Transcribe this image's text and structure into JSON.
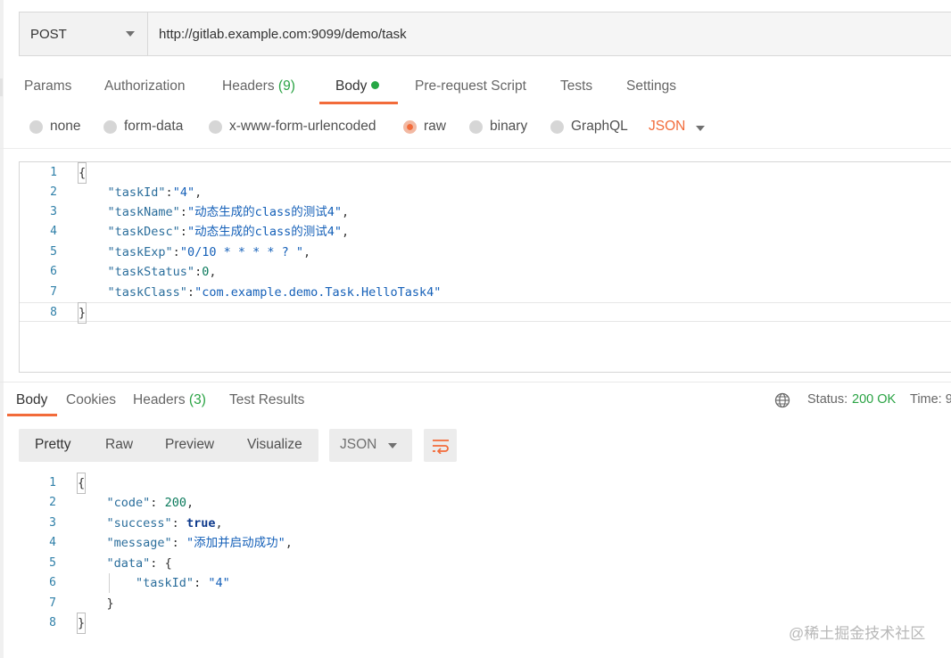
{
  "request": {
    "method": "POST",
    "url": "http://gitlab.example.com:9099/demo/task"
  },
  "request_tabs": {
    "params": "Params",
    "authorization": "Authorization",
    "headers": "Headers",
    "headers_count": "(9)",
    "body": "Body",
    "prerequest": "Pre-request Script",
    "tests": "Tests",
    "settings": "Settings"
  },
  "body_types": {
    "none": "none",
    "form_data": "form-data",
    "urlencoded": "x-www-form-urlencoded",
    "raw": "raw",
    "binary": "binary",
    "graphql": "GraphQL",
    "format": "JSON",
    "selected": "raw"
  },
  "request_body": {
    "line_numbers": [
      "1",
      "2",
      "3",
      "4",
      "5",
      "6",
      "7",
      "8"
    ],
    "l1": "{",
    "l2_key": "\"taskId\"",
    "l2_val": "\"4\"",
    "l3_key": "\"taskName\"",
    "l3_val": "\"动态生成的class的测试4\"",
    "l4_key": "\"taskDesc\"",
    "l4_val": "\"动态生成的class的测试4\"",
    "l5_key": "\"taskExp\"",
    "l5_val": "\"0/10 * * * * ? \"",
    "l6_key": "\"taskStatus\"",
    "l6_val": "0",
    "l7_key": "\"taskClass\"",
    "l7_val": "\"com.example.demo.Task.HelloTask4\"",
    "l8": "}"
  },
  "response_tabs": {
    "body": "Body",
    "cookies": "Cookies",
    "headers": "Headers",
    "headers_count": "(3)",
    "test_results": "Test Results"
  },
  "response_status": {
    "status_label": "Status:",
    "status_value": "200 OK",
    "time_label": "Time: 9"
  },
  "response_view": {
    "pretty": "Pretty",
    "raw": "Raw",
    "preview": "Preview",
    "visualize": "Visualize",
    "format": "JSON"
  },
  "response_body": {
    "line_numbers": [
      "1",
      "2",
      "3",
      "4",
      "5",
      "6",
      "7",
      "8"
    ],
    "l1": "{",
    "l2_key": "\"code\"",
    "l2_val": "200",
    "l3_key": "\"success\"",
    "l3_val": "true",
    "l4_key": "\"message\"",
    "l4_val": "\"添加并启动成功\"",
    "l5_key": "\"data\"",
    "l5_val": "{",
    "l6_key": "\"taskId\"",
    "l6_val": "\"4\"",
    "l7": "}",
    "l8": "}"
  },
  "watermark": "@稀土掘金技术社区",
  "colors": {
    "accent": "#f26b3a",
    "success": "#26a744",
    "string": "#1560b8",
    "number": "#0b7a5c",
    "key": "#2b6e9c"
  },
  "icons": [
    "chevron-down-icon",
    "globe-icon",
    "wrap-lines-icon",
    "status-dot-icon"
  ]
}
